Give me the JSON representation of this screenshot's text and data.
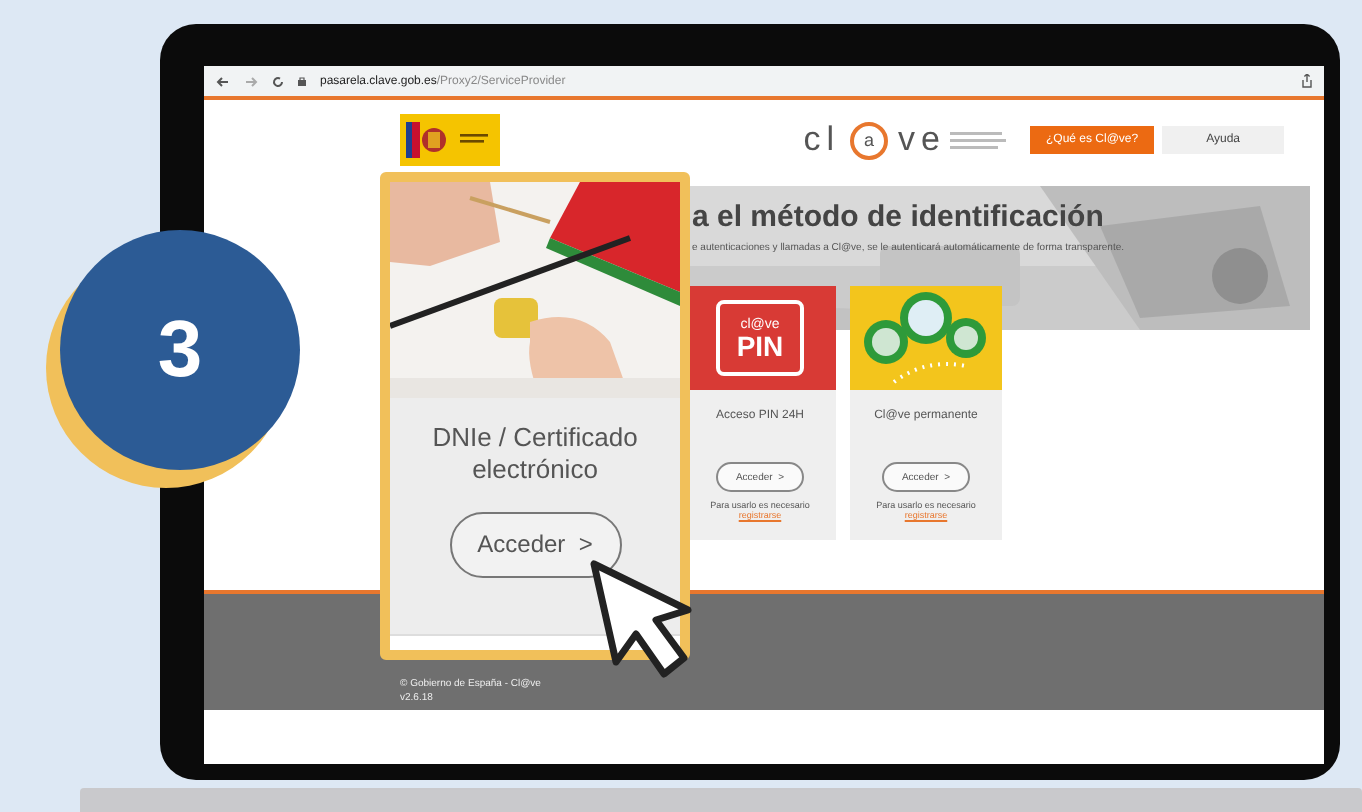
{
  "step_badge": "3",
  "browser": {
    "url_host": "pasarela.clave.gob.es",
    "url_path": "/Proxy2/ServiceProvider"
  },
  "header": {
    "logo_parts": [
      "cl",
      "a",
      "ve"
    ],
    "buttons": [
      {
        "label": "¿Qué es Cl@ve?",
        "kind": "primary"
      },
      {
        "label": "Ayuda",
        "kind": "plain"
      }
    ]
  },
  "hero": {
    "title": "a el método de identificación",
    "subtitle": "e autenticaciones y llamadas a Cl@ve, se le autenticará automáticamente de forma transparente."
  },
  "methods": [
    {
      "kind": "pin",
      "logo_top": "cl@ve",
      "logo_bottom": "PIN",
      "title": "Acceso PIN 24H",
      "button": "Acceder  >",
      "note": "Para usarlo es necesario",
      "link": "registrarse"
    },
    {
      "kind": "permanent",
      "title": "Cl@ve permanente",
      "button": "Acceder  >",
      "note": "Para usarlo es necesario",
      "link": "registrarse"
    }
  ],
  "highlighted_method": {
    "title": "DNIe / Certificado electrónico",
    "button": "Acceder  >"
  },
  "footer": {
    "lines": [
      "© Gobierno de España - Cl@ve",
      "v2.6.18"
    ]
  }
}
